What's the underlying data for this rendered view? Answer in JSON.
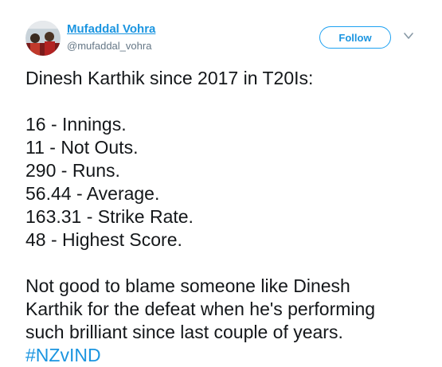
{
  "author": {
    "name": "Mufaddal Vohra",
    "handle": "@mufaddal_vohra"
  },
  "follow_label": "Follow",
  "tweet": {
    "intro": "Dinesh Karthik since 2017 in T20Is:",
    "stats": [
      "16 - Innings.",
      "11 - Not Outs.",
      "290 - Runs.",
      "56.44 - Average.",
      "163.31 - Strike Rate.",
      "48 - Highest Score."
    ],
    "closing_lines": [
      "Not good to blame someone like Dinesh",
      "Karthik for the defeat when he's performing",
      "such brilliant since last couple of years."
    ],
    "hashtag": "#NZvIND"
  },
  "colors": {
    "link": "#1b95e0",
    "text": "#14171a",
    "muted": "#657786"
  },
  "icons": {
    "avatar": "profile-photo",
    "caret": "chevron-down-icon"
  }
}
